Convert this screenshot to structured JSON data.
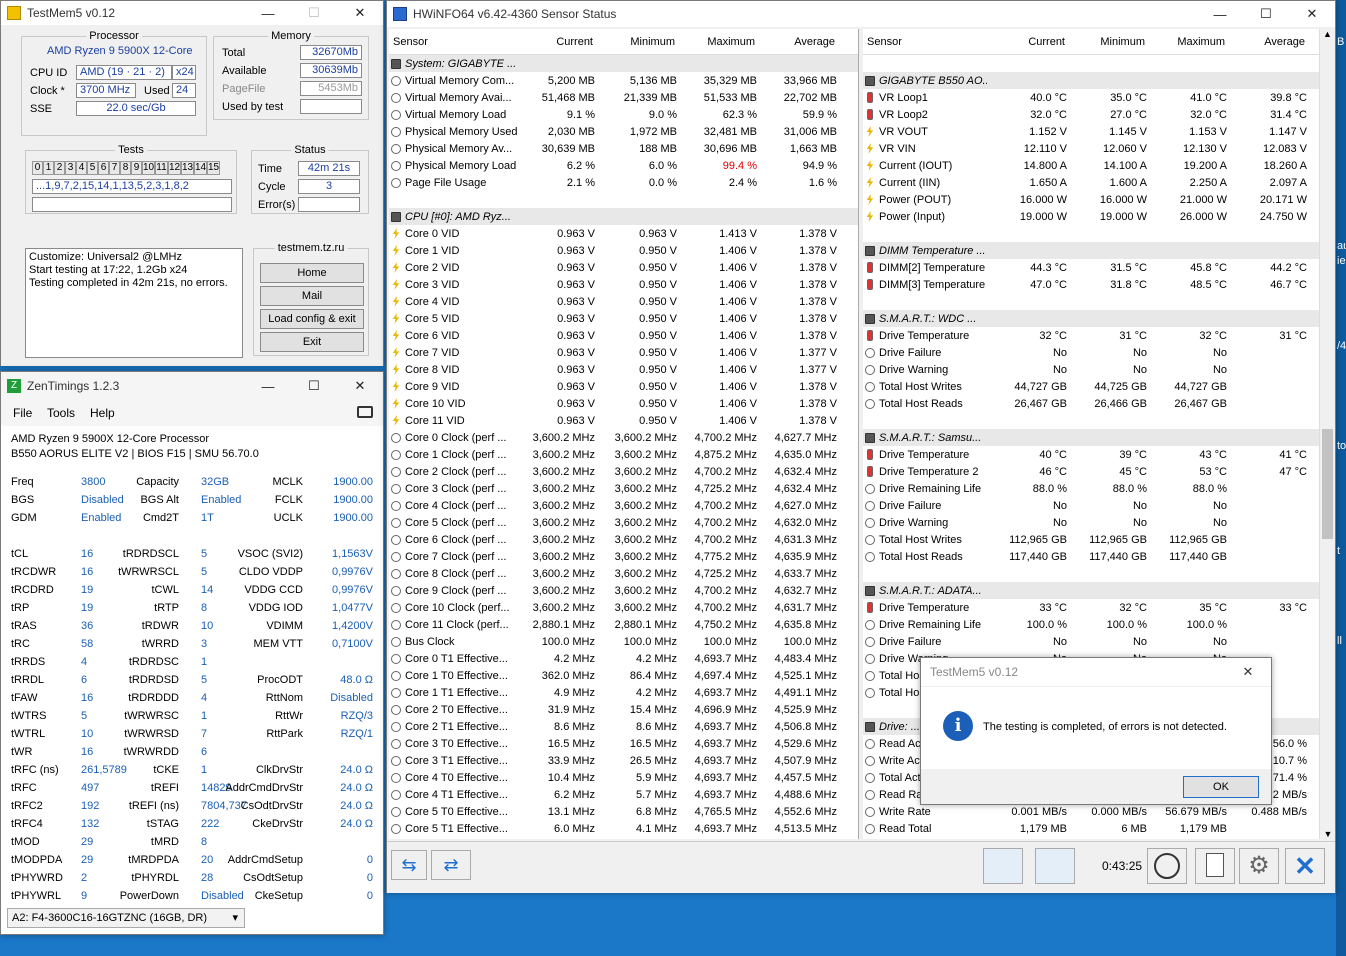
{
  "testmem": {
    "title": "TestMem5 v0.12",
    "processor_title": "Processor",
    "processor_name": "AMD Ryzen 9 5900X 12-Core",
    "cpuid_label": "CPU ID",
    "cpuid_value": "AMD  (19 · 21 · 2)",
    "cpuid_threads": "x24",
    "clock_label": "Clock *",
    "clock_value": "3700 MHz",
    "used_label": "Used",
    "used_value": "24",
    "sse_label": "SSE",
    "sse_value": "22.0 sec/Gb",
    "memory_title": "Memory",
    "total_label": "Total",
    "total_value": "32670Mb",
    "available_label": "Available",
    "available_value": "30639Mb",
    "pagefile_label": "PageFile",
    "pagefile_value": "5453Mb",
    "usedbytest_label": "Used by test",
    "usedbytest_value": "",
    "tests_title": "Tests",
    "test_cells": [
      "0",
      "1",
      "2",
      "3",
      "4",
      "5",
      "6",
      "7",
      "8",
      "9",
      "10",
      "11",
      "12",
      "13",
      "14",
      "15"
    ],
    "test_sequence": "...1,9,7,2,15,14,1,13,5,2,3,1,8,2",
    "status_title": "Status",
    "time_label": "Time",
    "time_value": "42m 21s",
    "cycle_label": "Cycle",
    "cycle_value": "3",
    "errors_label": "Error(s)",
    "errors_value": "",
    "log": [
      "Customize: Universal2 @LMHz",
      "Start testing at 17:22, 1.2Gb x24",
      "Testing completed in 42m 21s, no errors."
    ],
    "site": "testmem.tz.ru",
    "btn_home": "Home",
    "btn_mail": "Mail",
    "btn_load": "Load config & exit",
    "btn_exit": "Exit"
  },
  "zen": {
    "title": "ZenTimings 1.2.3",
    "menu": [
      "File",
      "Tools",
      "Help"
    ],
    "cpu": "AMD Ryzen 9 5900X 12-Core Processor",
    "board": "B550 AORUS ELITE V2 | BIOS F15 | SMU 56.70.0",
    "rows": [
      [
        "Freq",
        "3800",
        "Capacity",
        "32GB",
        "MCLK",
        "1900.00"
      ],
      [
        "BGS",
        "Disabled",
        "BGS Alt",
        "Enabled",
        "FCLK",
        "1900.00"
      ],
      [
        "GDM",
        "Enabled",
        "Cmd2T",
        "1T",
        "UCLK",
        "1900.00"
      ],
      [
        "",
        "",
        "",
        "",
        "",
        ""
      ],
      [
        "tCL",
        "16",
        "tRDRDSCL",
        "5",
        "VSOC (SVI2)",
        "1,1563V"
      ],
      [
        "tRCDWR",
        "16",
        "tWRWRSCL",
        "5",
        "CLDO VDDP",
        "0,9976V"
      ],
      [
        "tRCDRD",
        "19",
        "tCWL",
        "14",
        "VDDG CCD",
        "0,9976V"
      ],
      [
        "tRP",
        "19",
        "tRTP",
        "8",
        "VDDG IOD",
        "1,0477V"
      ],
      [
        "tRAS",
        "36",
        "tRDWR",
        "10",
        "VDIMM",
        "1,4200V"
      ],
      [
        "tRC",
        "58",
        "tWRRD",
        "3",
        "MEM VTT",
        "0,7100V"
      ],
      [
        "tRRDS",
        "4",
        "tRDRDSC",
        "1",
        "",
        ""
      ],
      [
        "tRRDL",
        "6",
        "tRDRDSD",
        "5",
        "ProcODT",
        "48.0 Ω"
      ],
      [
        "tFAW",
        "16",
        "tRDRDDD",
        "4",
        "RttNom",
        "Disabled"
      ],
      [
        "tWTRS",
        "5",
        "tWRWRSC",
        "1",
        "RttWr",
        "RZQ/3"
      ],
      [
        "tWTRL",
        "10",
        "tWRWRSD",
        "7",
        "RttPark",
        "RZQ/1"
      ],
      [
        "tWR",
        "16",
        "tWRWRDD",
        "6",
        "",
        ""
      ],
      [
        "tRFC (ns)",
        "261,5789",
        "tCKE",
        "1",
        "ClkDrvStr",
        "24.0 Ω"
      ],
      [
        "tRFC",
        "497",
        "tREFI",
        "14829",
        "AddrCmdDrvStr",
        "24.0 Ω"
      ],
      [
        "tRFC2",
        "192",
        "tREFI (ns)",
        "7804,737",
        "CsOdtDrvStr",
        "24.0 Ω"
      ],
      [
        "tRFC4",
        "132",
        "tSTAG",
        "222",
        "CkeDrvStr",
        "24.0 Ω"
      ],
      [
        "tMOD",
        "29",
        "tMRD",
        "8",
        "",
        ""
      ],
      [
        "tMODPDA",
        "29",
        "tMRDPDA",
        "20",
        "AddrCmdSetup",
        "0"
      ],
      [
        "tPHYWRD",
        "2",
        "tPHYRDL",
        "28",
        "CsOdtSetup",
        "0"
      ],
      [
        "tPHYWRL",
        "9",
        "PowerDown",
        "Disabled",
        "CkeSetup",
        "0"
      ]
    ],
    "dimm_select": "A2: F4-3600C16-16GTZNC (16GB, DR)"
  },
  "hw": {
    "title": "HWiNFO64 v6.42-4360 Sensor Status",
    "headers": [
      "Sensor",
      "Current",
      "Minimum",
      "Maximum",
      "Average"
    ],
    "left": [
      [
        "g",
        "System: GIGABYTE ...",
        "",
        "",
        "",
        ""
      ],
      [
        "c",
        "Virtual Memory Com...",
        "5,200 MB",
        "5,136 MB",
        "35,329 MB",
        "33,966 MB"
      ],
      [
        "c",
        "Virtual Memory Avai...",
        "51,468 MB",
        "21,339 MB",
        "51,533 MB",
        "22,702 MB"
      ],
      [
        "c",
        "Virtual Memory Load",
        "9.1 %",
        "9.0 %",
        "62.3 %",
        "59.9 %"
      ],
      [
        "c",
        "Physical Memory Used",
        "2,030 MB",
        "1,972 MB",
        "32,481 MB",
        "31,006 MB"
      ],
      [
        "c",
        "Physical Memory Av...",
        "30,639 MB",
        "188 MB",
        "30,696 MB",
        "1,663 MB"
      ],
      [
        "c",
        "Physical Memory Load",
        "6.2 %",
        "6.0 %",
        "99.4 %",
        "94.9 %"
      ],
      [
        "c",
        "Page File Usage",
        "2.1 %",
        "0.0 %",
        "2.4 %",
        "1.6 %"
      ],
      [
        "x",
        "",
        "",
        "",
        "",
        ""
      ],
      [
        "g",
        "CPU [#0]: AMD Ryz...",
        "",
        "",
        "",
        ""
      ],
      [
        "b",
        "Core 0 VID",
        "0.963 V",
        "0.963 V",
        "1.413 V",
        "1.378 V"
      ],
      [
        "b",
        "Core 1 VID",
        "0.963 V",
        "0.950 V",
        "1.406 V",
        "1.378 V"
      ],
      [
        "b",
        "Core 2 VID",
        "0.963 V",
        "0.950 V",
        "1.406 V",
        "1.378 V"
      ],
      [
        "b",
        "Core 3 VID",
        "0.963 V",
        "0.950 V",
        "1.406 V",
        "1.378 V"
      ],
      [
        "b",
        "Core 4 VID",
        "0.963 V",
        "0.950 V",
        "1.406 V",
        "1.378 V"
      ],
      [
        "b",
        "Core 5 VID",
        "0.963 V",
        "0.950 V",
        "1.406 V",
        "1.378 V"
      ],
      [
        "b",
        "Core 6 VID",
        "0.963 V",
        "0.950 V",
        "1.406 V",
        "1.378 V"
      ],
      [
        "b",
        "Core 7 VID",
        "0.963 V",
        "0.950 V",
        "1.406 V",
        "1.377 V"
      ],
      [
        "b",
        "Core 8 VID",
        "0.963 V",
        "0.950 V",
        "1.406 V",
        "1.377 V"
      ],
      [
        "b",
        "Core 9 VID",
        "0.963 V",
        "0.950 V",
        "1.406 V",
        "1.378 V"
      ],
      [
        "b",
        "Core 10 VID",
        "0.963 V",
        "0.950 V",
        "1.406 V",
        "1.378 V"
      ],
      [
        "b",
        "Core 11 VID",
        "0.963 V",
        "0.950 V",
        "1.406 V",
        "1.378 V"
      ],
      [
        "c",
        "Core 0 Clock (perf ...",
        "3,600.2 MHz",
        "3,600.2 MHz",
        "4,700.2 MHz",
        "4,627.7 MHz"
      ],
      [
        "c",
        "Core 1 Clock (perf ...",
        "3,600.2 MHz",
        "3,600.2 MHz",
        "4,875.2 MHz",
        "4,635.0 MHz"
      ],
      [
        "c",
        "Core 2 Clock (perf ...",
        "3,600.2 MHz",
        "3,600.2 MHz",
        "4,700.2 MHz",
        "4,632.4 MHz"
      ],
      [
        "c",
        "Core 3 Clock (perf ...",
        "3,600.2 MHz",
        "3,600.2 MHz",
        "4,725.2 MHz",
        "4,632.4 MHz"
      ],
      [
        "c",
        "Core 4 Clock (perf ...",
        "3,600.2 MHz",
        "3,600.2 MHz",
        "4,700.2 MHz",
        "4,627.0 MHz"
      ],
      [
        "c",
        "Core 5 Clock (perf ...",
        "3,600.2 MHz",
        "3,600.2 MHz",
        "4,700.2 MHz",
        "4,632.0 MHz"
      ],
      [
        "c",
        "Core 6 Clock (perf ...",
        "3,600.2 MHz",
        "3,600.2 MHz",
        "4,700.2 MHz",
        "4,631.3 MHz"
      ],
      [
        "c",
        "Core 7 Clock (perf ...",
        "3,600.2 MHz",
        "3,600.2 MHz",
        "4,775.2 MHz",
        "4,635.9 MHz"
      ],
      [
        "c",
        "Core 8 Clock (perf ...",
        "3,600.2 MHz",
        "3,600.2 MHz",
        "4,725.2 MHz",
        "4,633.7 MHz"
      ],
      [
        "c",
        "Core 9 Clock (perf ...",
        "3,600.2 MHz",
        "3,600.2 MHz",
        "4,700.2 MHz",
        "4,632.7 MHz"
      ],
      [
        "c",
        "Core 10 Clock (perf...",
        "3,600.2 MHz",
        "3,600.2 MHz",
        "4,700.2 MHz",
        "4,631.7 MHz"
      ],
      [
        "c",
        "Core 11 Clock (perf...",
        "2,880.1 MHz",
        "2,880.1 MHz",
        "4,750.2 MHz",
        "4,635.8 MHz"
      ],
      [
        "c",
        "Bus Clock",
        "100.0 MHz",
        "100.0 MHz",
        "100.0 MHz",
        "100.0 MHz"
      ],
      [
        "c",
        "Core 0 T1 Effective...",
        "4.2 MHz",
        "4.2 MHz",
        "4,693.7 MHz",
        "4,483.4 MHz"
      ],
      [
        "c",
        "Core 1 T0 Effective...",
        "362.0 MHz",
        "86.4 MHz",
        "4,697.4 MHz",
        "4,525.1 MHz"
      ],
      [
        "c",
        "Core 1 T1 Effective...",
        "4.9 MHz",
        "4.2 MHz",
        "4,693.7 MHz",
        "4,491.1 MHz"
      ],
      [
        "c",
        "Core 2 T0 Effective...",
        "31.9 MHz",
        "15.4 MHz",
        "4,696.9 MHz",
        "4,525.9 MHz"
      ],
      [
        "c",
        "Core 2 T1 Effective...",
        "8.6 MHz",
        "8.6 MHz",
        "4,693.7 MHz",
        "4,506.8 MHz"
      ],
      [
        "c",
        "Core 3 T0 Effective...",
        "16.5 MHz",
        "16.5 MHz",
        "4,693.7 MHz",
        "4,529.6 MHz"
      ],
      [
        "c",
        "Core 3 T1 Effective...",
        "33.9 MHz",
        "26.5 MHz",
        "4,693.7 MHz",
        "4,507.9 MHz"
      ],
      [
        "c",
        "Core 4 T0 Effective...",
        "10.4 MHz",
        "5.9 MHz",
        "4,693.7 MHz",
        "4,457.5 MHz"
      ],
      [
        "c",
        "Core 4 T1 Effective...",
        "6.2 MHz",
        "5.7 MHz",
        "4,693.7 MHz",
        "4,488.6 MHz"
      ],
      [
        "c",
        "Core 5 T0 Effective...",
        "13.1 MHz",
        "6.8 MHz",
        "4,765.5 MHz",
        "4,552.6 MHz"
      ],
      [
        "c",
        "Core 5 T1 Effective...",
        "6.0 MHz",
        "4.1 MHz",
        "4,693.7 MHz",
        "4,513.5 MHz"
      ]
    ],
    "right": [
      [
        "x",
        "",
        "",
        "",
        "",
        ""
      ],
      [
        "g",
        "GIGABYTE B550 AO...",
        "",
        "",
        "",
        ""
      ],
      [
        "t",
        "VR Loop1",
        "40.0 °C",
        "35.0 °C",
        "41.0 °C",
        "39.8 °C"
      ],
      [
        "t",
        "VR Loop2",
        "32.0 °C",
        "27.0 °C",
        "32.0 °C",
        "31.4 °C"
      ],
      [
        "b",
        "VR VOUT",
        "1.152 V",
        "1.145 V",
        "1.153 V",
        "1.147 V"
      ],
      [
        "b",
        "VR VIN",
        "12.110 V",
        "12.060 V",
        "12.130 V",
        "12.083 V"
      ],
      [
        "b",
        "Current (IOUT)",
        "14.800 A",
        "14.100 A",
        "19.200 A",
        "18.260 A"
      ],
      [
        "b",
        "Current (IIN)",
        "1.650 A",
        "1.600 A",
        "2.250 A",
        "2.097 A"
      ],
      [
        "b",
        "Power (POUT)",
        "16.000 W",
        "16.000 W",
        "21.000 W",
        "20.171 W"
      ],
      [
        "b",
        "Power (Input)",
        "19.000 W",
        "19.000 W",
        "26.000 W",
        "24.750 W"
      ],
      [
        "x",
        "",
        "",
        "",
        "",
        ""
      ],
      [
        "g",
        "DIMM Temperature ...",
        "",
        "",
        "",
        ""
      ],
      [
        "t",
        "DIMM[2] Temperature",
        "44.3 °C",
        "31.5 °C",
        "45.8 °C",
        "44.2 °C"
      ],
      [
        "t",
        "DIMM[3] Temperature",
        "47.0 °C",
        "31.8 °C",
        "48.5 °C",
        "46.7 °C"
      ],
      [
        "x",
        "",
        "",
        "",
        "",
        ""
      ],
      [
        "g",
        "S.M.A.R.T.: WDC ...",
        "",
        "",
        "",
        ""
      ],
      [
        "t",
        "Drive Temperature",
        "32 °C",
        "31 °C",
        "32 °C",
        "31 °C"
      ],
      [
        "c",
        "Drive Failure",
        "No",
        "No",
        "No",
        ""
      ],
      [
        "c",
        "Drive Warning",
        "No",
        "No",
        "No",
        ""
      ],
      [
        "c",
        "Total Host Writes",
        "44,727 GB",
        "44,725 GB",
        "44,727 GB",
        ""
      ],
      [
        "c",
        "Total Host Reads",
        "26,467 GB",
        "26,466 GB",
        "26,467 GB",
        ""
      ],
      [
        "x",
        "",
        "",
        "",
        "",
        ""
      ],
      [
        "g",
        "S.M.A.R.T.: Samsu...",
        "",
        "",
        "",
        ""
      ],
      [
        "t",
        "Drive Temperature",
        "40 °C",
        "39 °C",
        "43 °C",
        "41 °C"
      ],
      [
        "t",
        "Drive Temperature 2",
        "46 °C",
        "45 °C",
        "53 °C",
        "47 °C"
      ],
      [
        "c",
        "Drive Remaining Life",
        "88.0 %",
        "88.0 %",
        "88.0 %",
        ""
      ],
      [
        "c",
        "Drive Failure",
        "No",
        "No",
        "No",
        ""
      ],
      [
        "c",
        "Drive Warning",
        "No",
        "No",
        "No",
        ""
      ],
      [
        "c",
        "Total Host Writes",
        "112,965 GB",
        "112,965 GB",
        "112,965 GB",
        ""
      ],
      [
        "c",
        "Total Host Reads",
        "117,440 GB",
        "117,440 GB",
        "117,440 GB",
        ""
      ],
      [
        "x",
        "",
        "",
        "",
        "",
        ""
      ],
      [
        "g",
        "S.M.A.R.T.: ADATA...",
        "",
        "",
        "",
        ""
      ],
      [
        "t",
        "Drive Temperature",
        "33 °C",
        "32 °C",
        "35 °C",
        "33 °C"
      ],
      [
        "c",
        "Drive Remaining Life",
        "100.0 %",
        "100.0 %",
        "100.0 %",
        ""
      ],
      [
        "c",
        "Drive Failure",
        "No",
        "No",
        "No",
        ""
      ],
      [
        "c",
        "Drive Warning",
        "No",
        "No",
        "No",
        ""
      ],
      [
        "c",
        "Total Host Writes",
        "",
        "",
        "",
        ""
      ],
      [
        "c",
        "Total Host Reads",
        "",
        "",
        "",
        ""
      ],
      [
        "x",
        "",
        "",
        "",
        "",
        ""
      ],
      [
        "g",
        "Drive: ...",
        "",
        "",
        "",
        ""
      ],
      [
        "c",
        "Read Activity",
        "",
        "",
        "",
        "56.0 %"
      ],
      [
        "c",
        "Write Activity",
        "",
        "",
        "",
        "10.7 %"
      ],
      [
        "c",
        "Total Activity",
        "",
        "",
        "",
        "71.4 %"
      ],
      [
        "c",
        "Read Rate",
        "",
        "",
        "",
        "2 MB/s"
      ],
      [
        "c",
        "Write Rate",
        "0.001 MB/s",
        "0.000 MB/s",
        "56.679 MB/s",
        "0.488 MB/s"
      ],
      [
        "c",
        "Read Total",
        "1,179 MB",
        "6 MB",
        "1,179 MB",
        ""
      ]
    ],
    "timer": "0:43:25"
  },
  "dialog": {
    "title": "TestMem5 v0.12",
    "message": "The testing is completed, of errors is not detected.",
    "ok": "OK"
  },
  "edge_text": [
    "B",
    "au",
    "ie",
    "/4",
    "to",
    "t",
    "ll"
  ]
}
